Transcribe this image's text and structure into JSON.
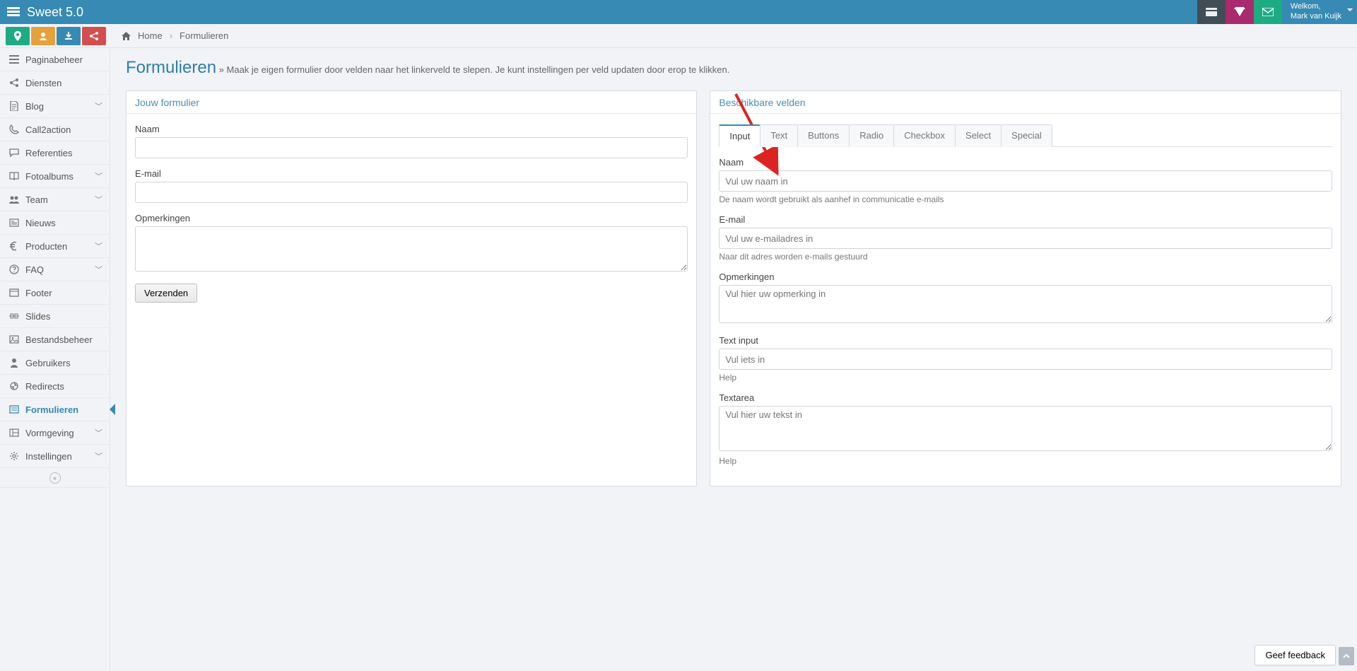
{
  "app": {
    "title": "Sweet 5.0"
  },
  "user": {
    "welcome": "Welkom,",
    "name": "Mark van Kuijk"
  },
  "breadcrumb": {
    "home": "Home",
    "current": "Formulieren"
  },
  "sidebar": {
    "items": [
      {
        "label": "Paginabeheer",
        "icon": "bars",
        "expand": false
      },
      {
        "label": "Diensten",
        "icon": "share",
        "expand": false
      },
      {
        "label": "Blog",
        "icon": "doc",
        "expand": true
      },
      {
        "label": "Call2action",
        "icon": "phone",
        "expand": false
      },
      {
        "label": "Referenties",
        "icon": "chat",
        "expand": false
      },
      {
        "label": "Fotoalbums",
        "icon": "book",
        "expand": true
      },
      {
        "label": "Team",
        "icon": "users",
        "expand": true
      },
      {
        "label": "Nieuws",
        "icon": "news",
        "expand": false
      },
      {
        "label": "Producten",
        "icon": "euro",
        "expand": true
      },
      {
        "label": "FAQ",
        "icon": "help",
        "expand": true
      },
      {
        "label": "Footer",
        "icon": "window",
        "expand": false
      },
      {
        "label": "Slides",
        "icon": "slides",
        "expand": false
      },
      {
        "label": "Bestandsbeheer",
        "icon": "image",
        "expand": false
      },
      {
        "label": "Gebruikers",
        "icon": "user",
        "expand": false
      },
      {
        "label": "Redirects",
        "icon": "redirect",
        "expand": false
      },
      {
        "label": "Formulieren",
        "icon": "form",
        "expand": false,
        "active": true
      },
      {
        "label": "Vormgeving",
        "icon": "layout",
        "expand": true
      },
      {
        "label": "Instellingen",
        "icon": "gear",
        "expand": true
      }
    ]
  },
  "page": {
    "title": "Formulieren",
    "subtitle": "» Maak je eigen formulier door velden naar het linkerveld te slepen. Je kunt instellingen per veld updaten door erop te klikken."
  },
  "leftPanel": {
    "title": "Jouw formulier",
    "fields": {
      "naam": {
        "label": "Naam"
      },
      "email": {
        "label": "E-mail"
      },
      "opm": {
        "label": "Opmerkingen"
      }
    },
    "submit": "Verzenden"
  },
  "rightPanel": {
    "title": "Beschikbare velden",
    "tabs": [
      "Input",
      "Text",
      "Buttons",
      "Radio",
      "Checkbox",
      "Select",
      "Special"
    ],
    "fields": {
      "naam": {
        "label": "Naam",
        "placeholder": "Vul uw naam in",
        "help": "De naam wordt gebruikt als aanhef in communicatie e-mails"
      },
      "email": {
        "label": "E-mail",
        "placeholder": "Vul uw e-mailadres in",
        "help": "Naar dit adres worden e-mails gestuurd"
      },
      "opm": {
        "label": "Opmerkingen",
        "placeholder": "Vul hier uw opmerking in"
      },
      "text": {
        "label": "Text input",
        "placeholder": "Vul iets in",
        "help": "Help"
      },
      "textarea": {
        "label": "Textarea",
        "placeholder": "Vul hier uw tekst in",
        "help": "Help"
      }
    }
  },
  "feedback": "Geef feedback"
}
